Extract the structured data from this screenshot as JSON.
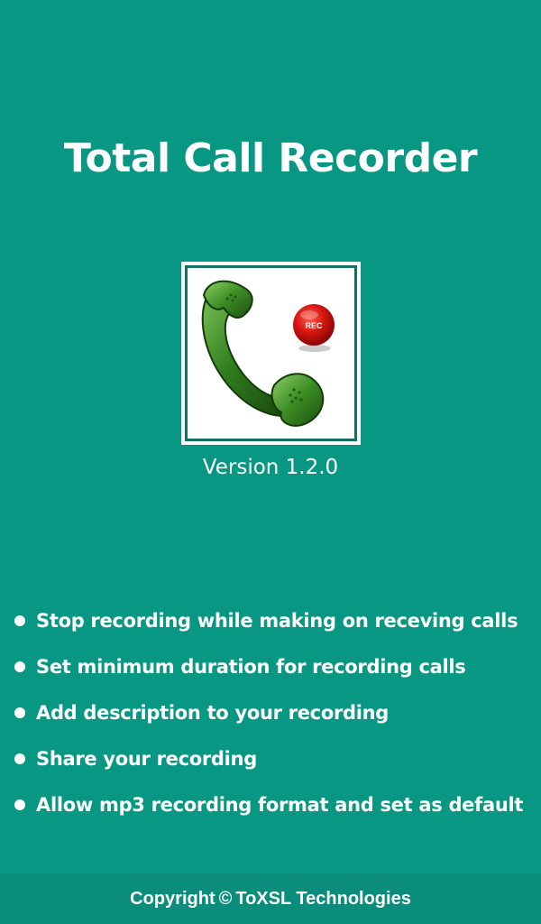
{
  "app": {
    "title": "Total Call Recorder",
    "version": "Version 1.2.0"
  },
  "logo": {
    "icon": "green-phone-handset-with-rec-button",
    "rec_label": "REC"
  },
  "features": [
    "Stop recording while making on receving calls",
    "Set minimum duration for recording calls",
    "Add description to your recording",
    "Share your recording",
    "Allow mp3 recording format and set as default"
  ],
  "footer": {
    "prefix": "Copyright",
    "symbol": "©",
    "company": "ToXSL Technologies"
  },
  "colors": {
    "background": "#079783",
    "footer_background": "#0a8e7b",
    "text": "#ffffff",
    "phone_green": "#2f7d1d",
    "rec_red": "#c80d0d"
  }
}
